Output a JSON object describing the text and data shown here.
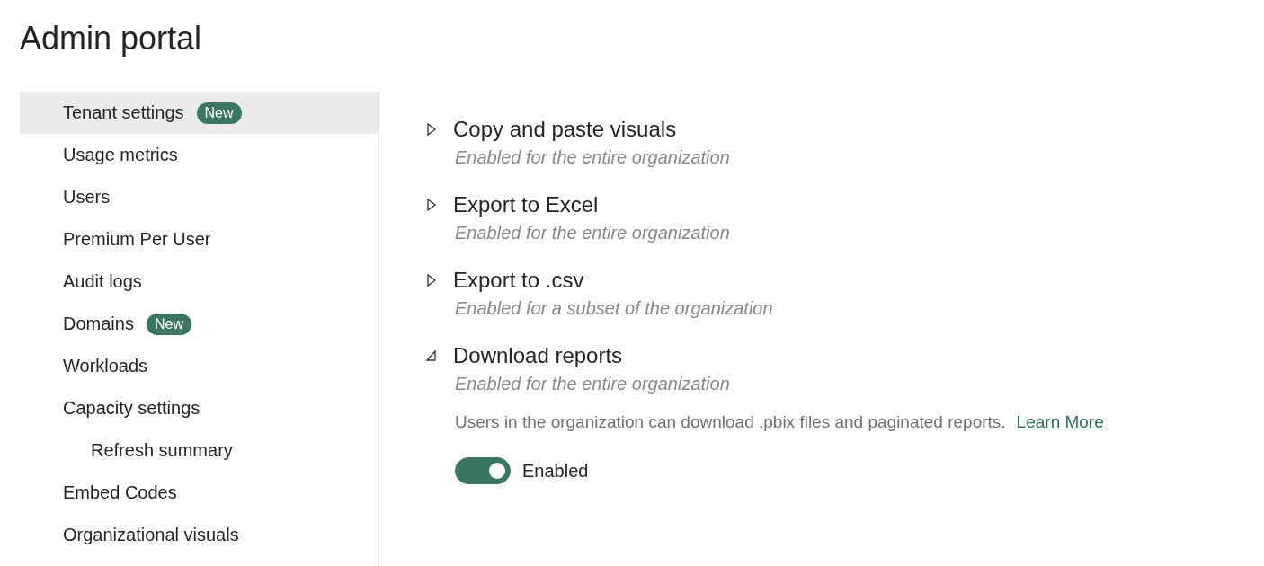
{
  "header": {
    "title": "Admin portal"
  },
  "sidebar": {
    "items": [
      {
        "label": "Tenant settings",
        "badge": "New",
        "selected": true
      },
      {
        "label": "Usage metrics",
        "selected": false
      },
      {
        "label": "Users",
        "selected": false
      },
      {
        "label": "Premium Per User",
        "selected": false
      },
      {
        "label": "Audit logs",
        "selected": false
      },
      {
        "label": "Domains",
        "badge": "New",
        "selected": false
      },
      {
        "label": "Workloads",
        "selected": false
      },
      {
        "label": "Capacity settings",
        "selected": false,
        "children": [
          {
            "label": "Refresh summary",
            "selected": false
          }
        ]
      },
      {
        "label": "Embed Codes",
        "selected": false
      },
      {
        "label": "Organizational visuals",
        "selected": false
      }
    ]
  },
  "settings": [
    {
      "title": "Copy and paste visuals",
      "status": "Enabled for the entire organization",
      "expanded": false
    },
    {
      "title": "Export to Excel",
      "status": "Enabled for the entire organization",
      "expanded": false
    },
    {
      "title": "Export to .csv",
      "status": "Enabled for a subset of the organization",
      "expanded": false
    },
    {
      "title": "Download reports",
      "status": "Enabled for the entire organization",
      "expanded": true,
      "description": "Users in the organization can download .pbix files and paginated reports.",
      "link": "Learn More",
      "toggle": {
        "on": true,
        "label": "Enabled"
      }
    }
  ]
}
